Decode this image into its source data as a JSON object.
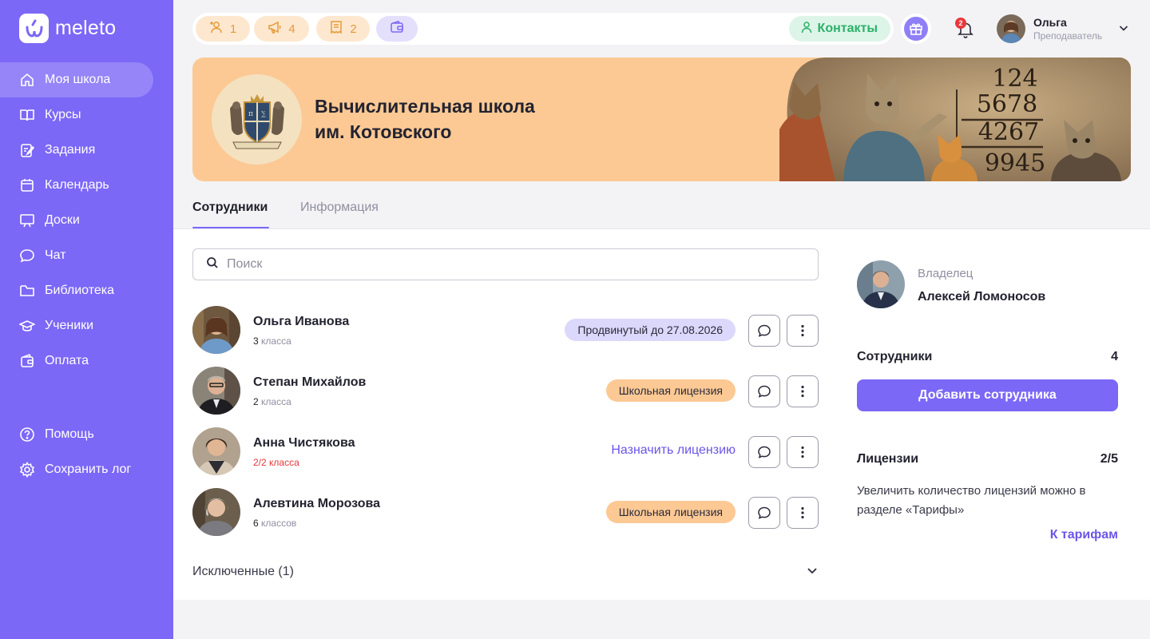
{
  "app": {
    "brand": "meleto"
  },
  "sidebar": {
    "items": [
      {
        "label": "Моя школа",
        "icon": "home-icon",
        "active": true
      },
      {
        "label": "Курсы",
        "icon": "book-icon"
      },
      {
        "label": "Задания",
        "icon": "edit-task-icon"
      },
      {
        "label": "Календарь",
        "icon": "calendar-icon"
      },
      {
        "label": "Доски",
        "icon": "board-icon"
      },
      {
        "label": "Чат",
        "icon": "chat-icon"
      },
      {
        "label": "Библиотека",
        "icon": "folder-icon"
      },
      {
        "label": "Ученики",
        "icon": "graduation-cap-icon"
      },
      {
        "label": "Оплата",
        "icon": "wallet-icon"
      }
    ],
    "bottom": [
      {
        "label": "Помощь",
        "icon": "help-icon"
      },
      {
        "label": "Сохранить лог",
        "icon": "gear-icon"
      }
    ]
  },
  "topbar": {
    "pills": [
      {
        "value": "1",
        "icon": "add-user-icon"
      },
      {
        "value": "4",
        "icon": "megaphone-icon"
      },
      {
        "value": "2",
        "icon": "receipt-icon"
      },
      {
        "value": "",
        "icon": "wallet-icon"
      }
    ],
    "contacts_label": "Контакты",
    "notifications_count": "2",
    "user": {
      "name": "Ольга",
      "role": "Преподаватель"
    }
  },
  "school": {
    "name_line1": "Вычислительная школа",
    "name_line2": "им. Котовского",
    "crest_text": "MATHEMATICA",
    "art_numbers": [
      "124",
      "5678",
      "4267",
      "9945"
    ]
  },
  "tabs": [
    {
      "label": "Сотрудники",
      "active": true
    },
    {
      "label": "Информация",
      "active": false
    }
  ],
  "search": {
    "placeholder": "Поиск"
  },
  "employees": [
    {
      "name": "Ольга Иванова",
      "classes_num": "3",
      "classes_word": "класса",
      "license": "Продвинутый до 27.08.2026",
      "license_style": "violet"
    },
    {
      "name": "Степан Михайлов",
      "classes_num": "2",
      "classes_word": "класса",
      "license": "Школьная лицензия",
      "license_style": "orange"
    },
    {
      "name": "Анна Чистякова",
      "classes_num": "2/2",
      "classes_word": "класса",
      "license": "Назначить лицензию",
      "license_style": "link"
    },
    {
      "name": "Алевтина Морозова",
      "classes_num": "6",
      "classes_word": "классов",
      "license": "Школьная лицензия",
      "license_style": "orange"
    }
  ],
  "excluded": {
    "label": "Исключенные (1)"
  },
  "owner_card": {
    "label": "Владелец",
    "name": "Алексей Ломоносов"
  },
  "staff_card": {
    "title": "Сотрудники",
    "count": "4",
    "add_button": "Добавить сотрудника"
  },
  "license_card": {
    "title": "Лицензии",
    "count": "2/5",
    "text": "Увеличить количество лицензий можно в разделе «Тарифы»",
    "link": "К тарифам"
  },
  "colors": {
    "accent": "#7b68f6",
    "banner": "#fcc994",
    "success": "#2cb06a",
    "danger": "#e8373c"
  }
}
